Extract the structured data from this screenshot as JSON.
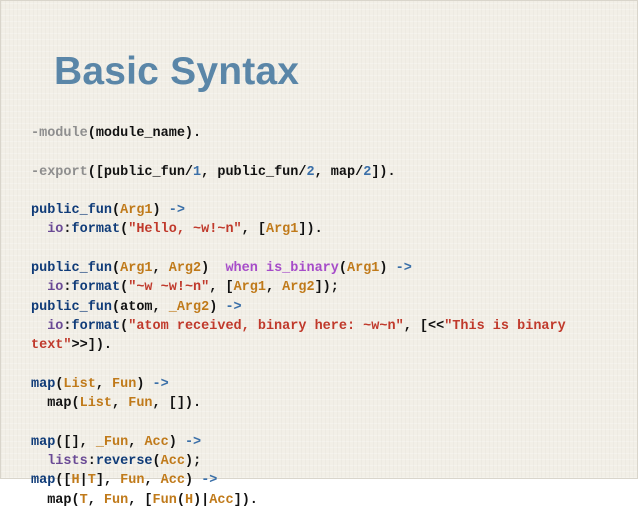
{
  "slide": {
    "title": "Basic Syntax"
  },
  "colors": {
    "title": "#5a86a8",
    "background": "#f2efe7",
    "keyword": "#8e8e8e",
    "function": "#0f3b78",
    "variable": "#c07a1a",
    "number": "#3a6fa8",
    "string": "#c0392b",
    "guard": "#a64cc9",
    "module": "#6a4a95",
    "text": "#111111"
  },
  "code": {
    "lines": [
      [
        [
          "kw",
          "-module"
        ],
        [
          "plain",
          "(module_name)."
        ]
      ],
      [],
      [
        [
          "kw",
          "-export"
        ],
        [
          "plain",
          "([public_fun/"
        ],
        [
          "num",
          "1"
        ],
        [
          "plain",
          ", public_fun/"
        ],
        [
          "num",
          "2"
        ],
        [
          "plain",
          ", map/"
        ],
        [
          "num",
          "2"
        ],
        [
          "plain",
          "])."
        ]
      ],
      [],
      [
        [
          "fn",
          "public_fun"
        ],
        [
          "plain",
          "("
        ],
        [
          "var",
          "Arg1"
        ],
        [
          "plain",
          ") "
        ],
        [
          "num",
          "->"
        ]
      ],
      [
        [
          "plain",
          "  "
        ],
        [
          "mod",
          "io"
        ],
        [
          "plain",
          ":"
        ],
        [
          "fn",
          "format"
        ],
        [
          "plain",
          "("
        ],
        [
          "str",
          "\"Hello, ~w!~n\""
        ],
        [
          "plain",
          ", ["
        ],
        [
          "var",
          "Arg1"
        ],
        [
          "plain",
          "])."
        ]
      ],
      [],
      [
        [
          "fn",
          "public_fun"
        ],
        [
          "plain",
          "("
        ],
        [
          "var",
          "Arg1"
        ],
        [
          "plain",
          ", "
        ],
        [
          "var",
          "Arg2"
        ],
        [
          "plain",
          ")  "
        ],
        [
          "guard",
          "when"
        ],
        [
          "plain",
          " "
        ],
        [
          "guard",
          "is_binary"
        ],
        [
          "plain",
          "("
        ],
        [
          "var",
          "Arg1"
        ],
        [
          "plain",
          ") "
        ],
        [
          "num",
          "->"
        ]
      ],
      [
        [
          "plain",
          "  "
        ],
        [
          "mod",
          "io"
        ],
        [
          "plain",
          ":"
        ],
        [
          "fn",
          "format"
        ],
        [
          "plain",
          "("
        ],
        [
          "str",
          "\"~w ~w!~n\""
        ],
        [
          "plain",
          ", ["
        ],
        [
          "var",
          "Arg1"
        ],
        [
          "plain",
          ", "
        ],
        [
          "var",
          "Arg2"
        ],
        [
          "plain",
          "]);"
        ]
      ],
      [
        [
          "fn",
          "public_fun"
        ],
        [
          "plain",
          "(atom, "
        ],
        [
          "var",
          "_Arg2"
        ],
        [
          "plain",
          ") "
        ],
        [
          "num",
          "->"
        ]
      ],
      [
        [
          "plain",
          "  "
        ],
        [
          "mod",
          "io"
        ],
        [
          "plain",
          ":"
        ],
        [
          "fn",
          "format"
        ],
        [
          "plain",
          "("
        ],
        [
          "str",
          "\"atom received, binary here: ~w~n\""
        ],
        [
          "plain",
          ", [<<"
        ],
        [
          "str",
          "\"This is binary"
        ]
      ],
      [
        [
          "str",
          "text\""
        ],
        [
          "plain",
          ">>])."
        ]
      ],
      [],
      [
        [
          "fn",
          "map"
        ],
        [
          "plain",
          "("
        ],
        [
          "var",
          "List"
        ],
        [
          "plain",
          ", "
        ],
        [
          "var",
          "Fun"
        ],
        [
          "plain",
          ") "
        ],
        [
          "num",
          "->"
        ]
      ],
      [
        [
          "plain",
          "  map("
        ],
        [
          "var",
          "List"
        ],
        [
          "plain",
          ", "
        ],
        [
          "var",
          "Fun"
        ],
        [
          "plain",
          ", [])."
        ]
      ],
      [],
      [
        [
          "fn",
          "map"
        ],
        [
          "plain",
          "([], "
        ],
        [
          "var",
          "_Fun"
        ],
        [
          "plain",
          ", "
        ],
        [
          "var",
          "Acc"
        ],
        [
          "plain",
          ") "
        ],
        [
          "num",
          "->"
        ]
      ],
      [
        [
          "plain",
          "  "
        ],
        [
          "mod",
          "lists"
        ],
        [
          "plain",
          ":"
        ],
        [
          "fn",
          "reverse"
        ],
        [
          "plain",
          "("
        ],
        [
          "var",
          "Acc"
        ],
        [
          "plain",
          ");"
        ]
      ],
      [
        [
          "fn",
          "map"
        ],
        [
          "plain",
          "(["
        ],
        [
          "var",
          "H"
        ],
        [
          "plain",
          "|"
        ],
        [
          "var",
          "T"
        ],
        [
          "plain",
          "], "
        ],
        [
          "var",
          "Fun"
        ],
        [
          "plain",
          ", "
        ],
        [
          "var",
          "Acc"
        ],
        [
          "plain",
          ") "
        ],
        [
          "num",
          "->"
        ]
      ],
      [
        [
          "plain",
          "  map("
        ],
        [
          "var",
          "T"
        ],
        [
          "plain",
          ", "
        ],
        [
          "var",
          "Fun"
        ],
        [
          "plain",
          ", ["
        ],
        [
          "var",
          "Fun"
        ],
        [
          "plain",
          "("
        ],
        [
          "var",
          "H"
        ],
        [
          "plain",
          ")|"
        ],
        [
          "var",
          "Acc"
        ],
        [
          "plain",
          "])."
        ]
      ]
    ]
  }
}
